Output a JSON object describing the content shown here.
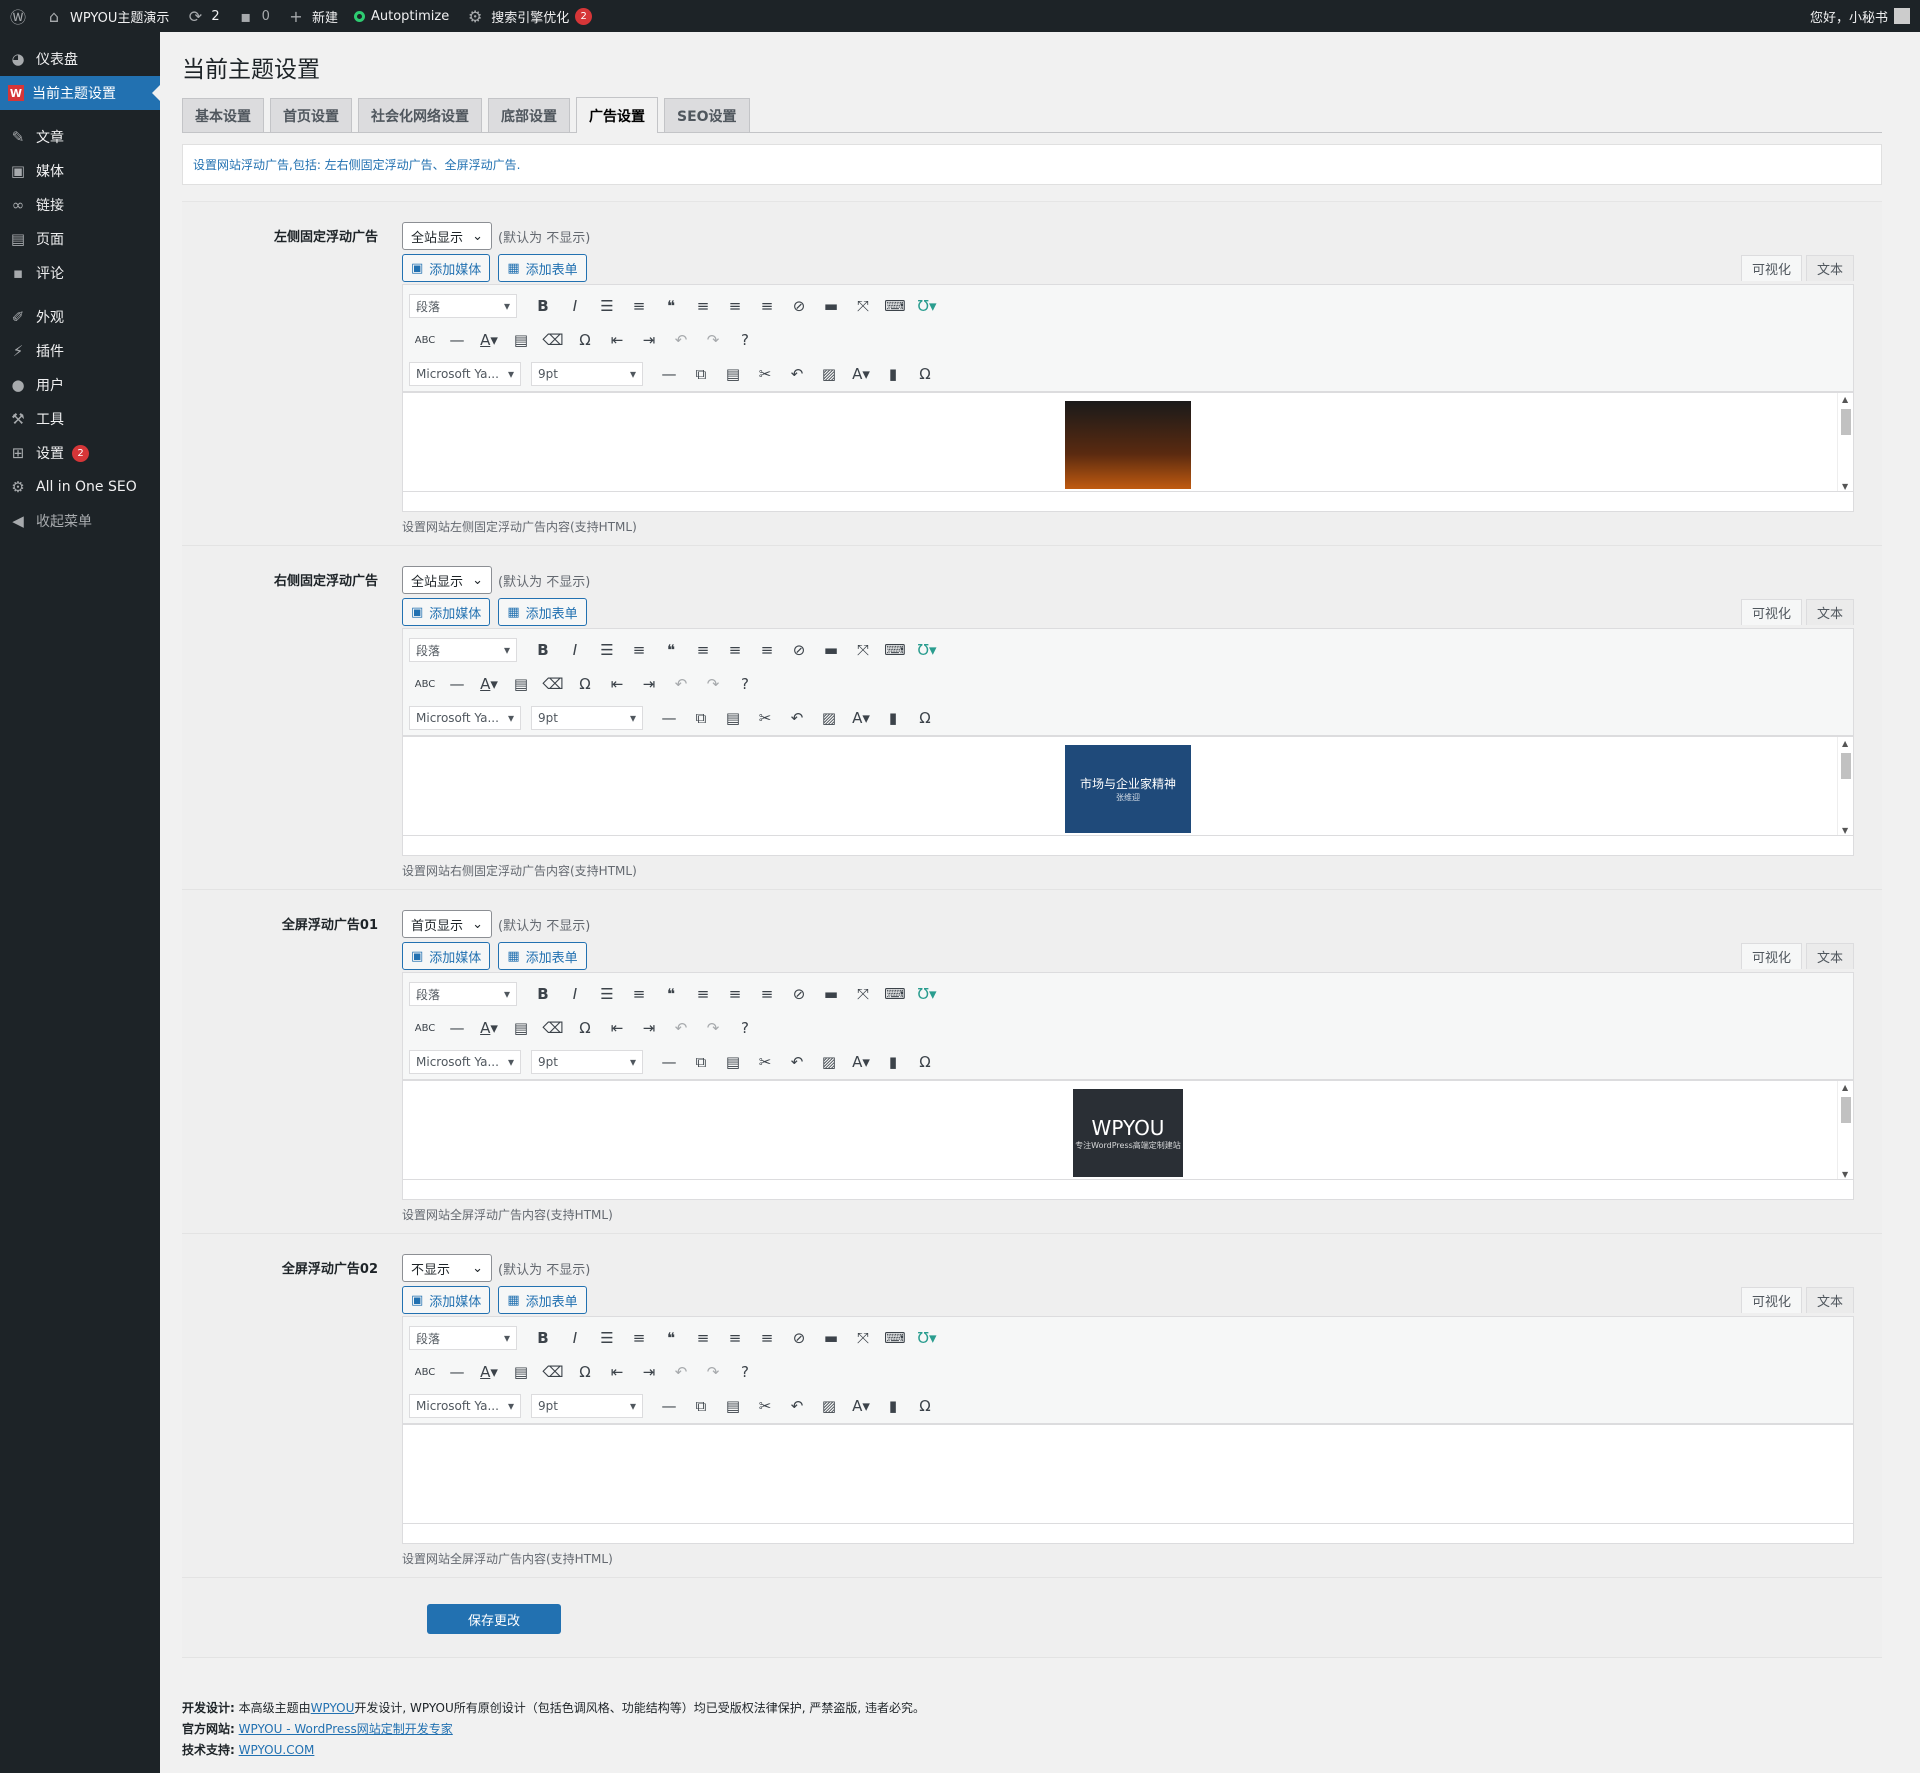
{
  "adminbar": {
    "site": "WPYOU主题演示",
    "updates": "2",
    "comments": "0",
    "new_label": "新建",
    "autoptimize": "Autoptimize",
    "seo": "搜索引擎优化",
    "seo_badge": "2",
    "greeting": "您好，小秘书"
  },
  "menu": {
    "dashboard": "仪表盘",
    "theme": "当前主题设置",
    "posts": "文章",
    "media": "媒体",
    "links": "链接",
    "pages": "页面",
    "comments": "评论",
    "appearance": "外观",
    "plugins": "插件",
    "users": "用户",
    "tools": "工具",
    "settings": "设置",
    "settings_badge": "2",
    "aioseo": "All in One SEO",
    "collapse": "收起菜单"
  },
  "page": {
    "title": "当前主题设置",
    "notice": "设置网站浮动广告,包括: 左右侧固定浮动广告、全屏浮动广告."
  },
  "tabs": [
    "基本设置",
    "首页设置",
    "社会化网络设置",
    "底部设置",
    "广告设置",
    "SEO设置"
  ],
  "common": {
    "default_hint": "(默认为 不显示)",
    "add_media": "添加媒体",
    "add_form": "添加表单",
    "visual": "可视化",
    "text": "文本",
    "paragraph": "段落",
    "font": "Microsoft Ya...",
    "size": "9pt"
  },
  "fields": [
    {
      "label": "左侧固定浮动广告",
      "select": "全站显示",
      "desc": "设置网站左侧固定浮动广告内容(支持HTML)",
      "thumb_text": "",
      "thumb_sub": ""
    },
    {
      "label": "右侧固定浮动广告",
      "select": "全站显示",
      "desc": "设置网站右侧固定浮动广告内容(支持HTML)",
      "thumb_text": "市场与企业家精神",
      "thumb_sub": "张维迎"
    },
    {
      "label": "全屏浮动广告01",
      "select": "首页显示",
      "desc": "设置网站全屏浮动广告内容(支持HTML)",
      "thumb_text": "WPYOU",
      "thumb_sub": "专注WordPress高端定制建站"
    },
    {
      "label": "全屏浮动广告02",
      "select": "不显示",
      "desc": "设置网站全屏浮动广告内容(支持HTML)",
      "thumb_text": "",
      "thumb_sub": ""
    }
  ],
  "save": "保存更改",
  "footer": {
    "l1_label": "开发设计:",
    "l1_a": "本高级主题由",
    "l1_link": "WPYOU",
    "l1_b": "开发设计, WPYOU所有原创设计（包括色调风格、功能结构等）均已受版权法律保护, 严禁盗版, 违者必究。",
    "l2_label": "官方网站:",
    "l2_link": "WPYOU - WordPress网站定制开发专家",
    "l3_label": "技术支持:",
    "l3_link": "WPYOU.COM"
  }
}
